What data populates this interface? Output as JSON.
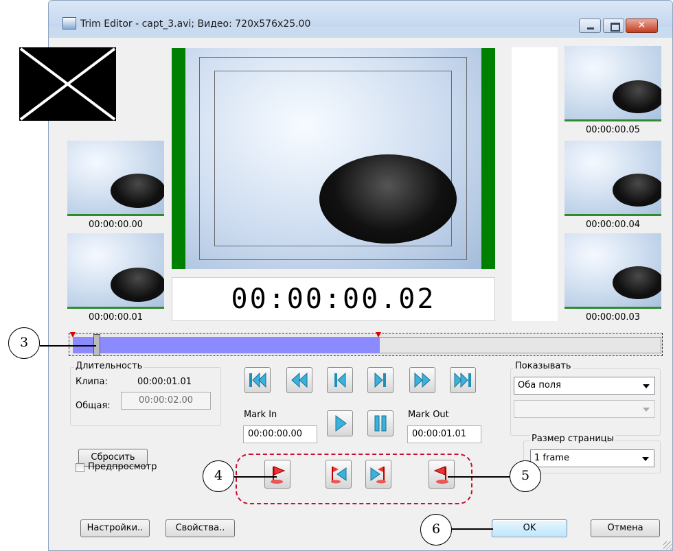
{
  "window": {
    "title": "Trim Editor - capt_3.avi; Видео: 720x576x25.00"
  },
  "thumbnails": {
    "left": [
      "00:00:00.00",
      "00:00:00.01"
    ],
    "right": [
      "00:00:00.05",
      "00:00:00.04",
      "00:00:00.03"
    ]
  },
  "current_timecode": "00:00:00.02",
  "timeline": {
    "selection_fraction": 0.52
  },
  "duration": {
    "group_label": "Длительность",
    "clip_label": "Клипа:",
    "clip_value": "00:00:01.01",
    "total_label": "Общая:",
    "total_value": "00:00:02.00"
  },
  "transport": {
    "buttons": [
      "go-to-start",
      "rewind",
      "step-back",
      "step-forward",
      "fast-forward",
      "go-to-end"
    ],
    "play": "play",
    "pause": "pause"
  },
  "marks": {
    "in_label": "Mark In",
    "in_value": "00:00:00.00",
    "out_label": "Mark Out",
    "out_value": "00:00:01.01"
  },
  "show": {
    "group_label": "Показывать",
    "selected": "Оба поля",
    "second_selected": ""
  },
  "page_size": {
    "group_label": "Размер страницы",
    "selected": "1 frame"
  },
  "buttons": {
    "reset": "Сбросить",
    "preview": "Предпросмотр",
    "settings": "Настройки..",
    "properties": "Свойства..",
    "ok": "OK",
    "cancel": "Отмена"
  },
  "callouts": [
    "3",
    "4",
    "5",
    "6"
  ],
  "colors": {
    "accent_green": "#008000",
    "timeline_fill": "#8b8bff",
    "callout_dash": "#c8102e"
  }
}
